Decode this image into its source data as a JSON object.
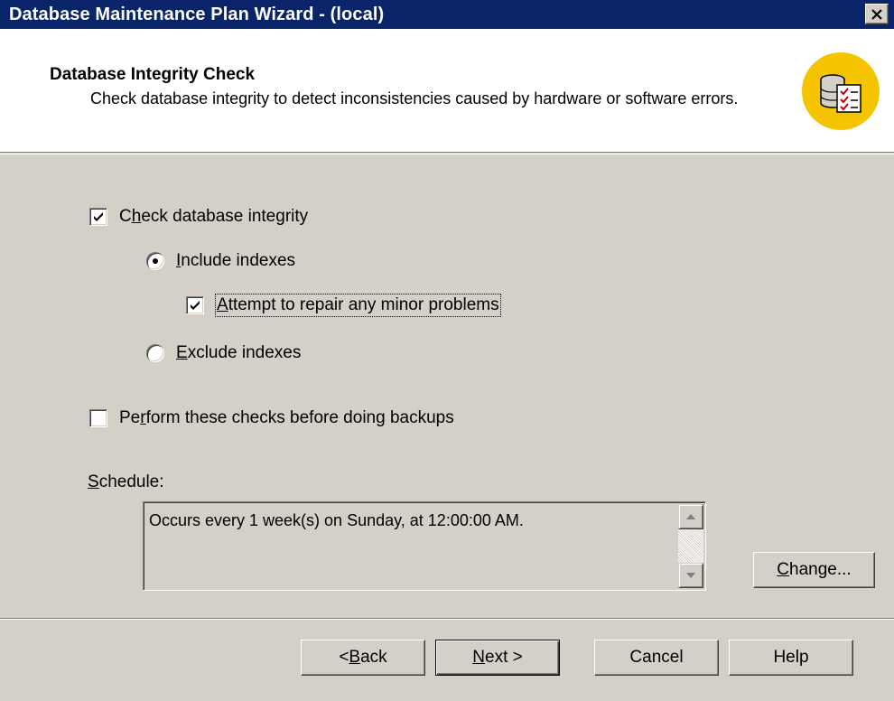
{
  "window": {
    "title": "Database Maintenance Plan Wizard - (local)",
    "close_icon": "close-icon"
  },
  "header": {
    "title": "Database Integrity Check",
    "description": "Check database integrity to detect inconsistencies caused by hardware or software errors.",
    "icon": "database-checklist-icon"
  },
  "options": {
    "check_integrity": {
      "label_pre": "C",
      "label_u": "h",
      "label_post": "eck database integrity",
      "checked": true
    },
    "include_indexes": {
      "label_pre": "",
      "label_u": "I",
      "label_post": "nclude indexes",
      "selected": true
    },
    "repair_minor": {
      "label_pre": "",
      "label_u": "A",
      "label_post": "ttempt to repair any minor problems",
      "checked": true
    },
    "exclude_indexes": {
      "label_pre": "",
      "label_u": "E",
      "label_post": "xclude indexes",
      "selected": false
    },
    "before_backups": {
      "label_pre": "Pe",
      "label_u": "r",
      "label_post": "form these checks before doing backups",
      "checked": false
    }
  },
  "schedule": {
    "label_u": "S",
    "label_post": "chedule:",
    "text": "Occurs every 1 week(s) on Sunday, at 12:00:00 AM.",
    "change_u": "C",
    "change_post": "hange..."
  },
  "footer": {
    "back_pre": "< ",
    "back_u": "B",
    "back_post": "ack",
    "next_u": "N",
    "next_post": "ext >",
    "cancel": "Cancel",
    "help": "Help"
  },
  "colors": {
    "titlebar": "#0a246a",
    "dialog_bg": "#d4d0c8",
    "icon_bg": "#f5c400"
  }
}
